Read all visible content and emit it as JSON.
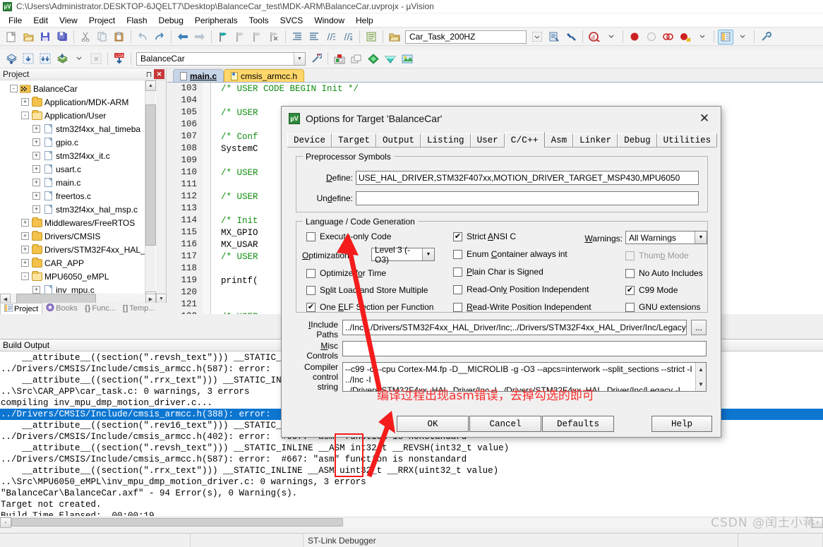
{
  "window": {
    "title": "C:\\Users\\Administrator.DESKTOP-6JQELT7\\Desktop\\BalanceCar_test\\MDK-ARM\\BalanceCar.uvprojx  -  µVision",
    "app_icon": "uvision-icon"
  },
  "menubar": {
    "items": [
      "File",
      "Edit",
      "View",
      "Project",
      "Flash",
      "Debug",
      "Peripherals",
      "Tools",
      "SVCS",
      "Window",
      "Help"
    ]
  },
  "toolbar1": {
    "target_combo_value": "Car_Task_200HZ",
    "icons": [
      "new-file-icon",
      "open-file-icon",
      "save-icon",
      "save-all-icon",
      "cut-icon",
      "copy-icon",
      "paste-icon",
      "undo-icon",
      "redo-icon",
      "navigate-back-icon",
      "navigate-forward-icon",
      "bookmark-toggle-icon",
      "bookmark-prev-icon",
      "bookmark-next-icon",
      "bookmark-clear-icon",
      "indent-icon",
      "outdent-icon",
      "comment-icon",
      "uncomment-icon"
    ]
  },
  "toolbar2": {
    "project_combo_value": "BalanceCar",
    "icons": [
      "build-icon",
      "rebuild-icon",
      "batch-build-icon",
      "translate-icon",
      "stop-build-icon",
      "download-icon",
      "target-options-icon",
      "manage-components-icon",
      "multi-project-icon",
      "pack-installer-icon",
      "pack-icon",
      "pack-manager-icon"
    ]
  },
  "project_panel": {
    "header": "Project",
    "pin_icon": "pin-icon",
    "close_icon": "close-icon",
    "tree": [
      {
        "label": "BalanceCar",
        "icon": "project-target-icon",
        "depth": 1,
        "expander": "-"
      },
      {
        "label": "Application/MDK-ARM",
        "icon": "folder-icon",
        "depth": 2,
        "expander": "+"
      },
      {
        "label": "Application/User",
        "icon": "folder-open-icon",
        "depth": 2,
        "expander": "-"
      },
      {
        "label": "stm32f4xx_hal_timeba",
        "icon": "c-file-icon",
        "depth": 3,
        "expander": "+"
      },
      {
        "label": "gpio.c",
        "icon": "c-file-icon",
        "depth": 3,
        "expander": "+"
      },
      {
        "label": "stm32f4xx_it.c",
        "icon": "c-file-icon",
        "depth": 3,
        "expander": "+"
      },
      {
        "label": "usart.c",
        "icon": "c-file-icon",
        "depth": 3,
        "expander": "+"
      },
      {
        "label": "main.c",
        "icon": "c-file-icon",
        "depth": 3,
        "expander": "+"
      },
      {
        "label": "freertos.c",
        "icon": "c-file-icon",
        "depth": 3,
        "expander": "+"
      },
      {
        "label": "stm32f4xx_hal_msp.c",
        "icon": "c-file-icon",
        "depth": 3,
        "expander": "+"
      },
      {
        "label": "Middlewares/FreeRTOS",
        "icon": "folder-icon",
        "depth": 2,
        "expander": "+"
      },
      {
        "label": "Drivers/CMSIS",
        "icon": "folder-icon",
        "depth": 2,
        "expander": "+"
      },
      {
        "label": "Drivers/STM32F4xx_HAL_",
        "icon": "folder-icon",
        "depth": 2,
        "expander": "+"
      },
      {
        "label": "CAR_APP",
        "icon": "folder-icon",
        "depth": 2,
        "expander": "+"
      },
      {
        "label": "MPU6050_eMPL",
        "icon": "folder-open-icon",
        "depth": 2,
        "expander": "-"
      },
      {
        "label": "inv_mpu.c",
        "icon": "c-file-icon",
        "depth": 3,
        "expander": "+"
      }
    ],
    "tabs": [
      {
        "label": "Project",
        "icon": "project-icon",
        "selected": true
      },
      {
        "label": "Books",
        "icon": "books-icon",
        "selected": false
      },
      {
        "label": "Func...",
        "icon": "functions-icon",
        "selected": false
      },
      {
        "label": "Temp...",
        "icon": "templates-icon",
        "selected": false
      }
    ]
  },
  "editor": {
    "tabs": [
      {
        "label": "main.c",
        "icon": "c-file-icon",
        "selected": true
      },
      {
        "label": "cmsis_armcc.h",
        "icon": "h-file-icon",
        "selected": false
      }
    ],
    "lines": [
      {
        "num": "103",
        "text": "/* USER CODE BEGIN Init */",
        "kind": "comment"
      },
      {
        "num": "104",
        "text": "",
        "kind": "plain"
      },
      {
        "num": "105",
        "text": "/* USER",
        "kind": "comment"
      },
      {
        "num": "106",
        "text": "",
        "kind": "plain"
      },
      {
        "num": "107",
        "text": "/* Conf",
        "kind": "comment"
      },
      {
        "num": "108",
        "text": "SystemC",
        "kind": "plain"
      },
      {
        "num": "109",
        "text": "",
        "kind": "plain"
      },
      {
        "num": "110",
        "text": "/* USER",
        "kind": "comment"
      },
      {
        "num": "111",
        "text": "",
        "kind": "plain"
      },
      {
        "num": "112",
        "text": "/* USER",
        "kind": "comment"
      },
      {
        "num": "113",
        "text": "",
        "kind": "plain"
      },
      {
        "num": "114",
        "text": "/* Init",
        "kind": "comment"
      },
      {
        "num": "115",
        "text": "MX_GPIO",
        "kind": "plain"
      },
      {
        "num": "116",
        "text": "MX_USAR",
        "kind": "plain"
      },
      {
        "num": "117",
        "text": "/* USER",
        "kind": "comment"
      },
      {
        "num": "118",
        "text": "",
        "kind": "plain"
      },
      {
        "num": "119",
        "text": "printf(",
        "kind": "plain"
      },
      {
        "num": "120",
        "text": "",
        "kind": "plain"
      },
      {
        "num": "121",
        "text": "",
        "kind": "plain"
      },
      {
        "num": "122",
        "text": "/* USER",
        "kind": "comment"
      },
      {
        "num": "123",
        "text": "",
        "kind": "plain"
      }
    ]
  },
  "build_output": {
    "header": "Build Output",
    "lines": [
      {
        "text": "    __attribute__((section(\".revsh_text\"))) __STATIC_INLINE __ASM int32_t __REVSH(int32_t value)",
        "selected": false
      },
      {
        "text": "../Drivers/CMSIS/Include/cmsis_armcc.h(587): error:  #667: \"asm\" function is nonstandard",
        "selected": false
      },
      {
        "text": "    __attribute__((section(\".rrx_text\"))) __STATIC_INLINE __ASM uint32_t __RRX(uint32_t value)",
        "selected": false
      },
      {
        "text": "..\\Src\\CAR_APP\\car_task.c: 0 warnings, 3 errors",
        "selected": false
      },
      {
        "text": "compiling inv_mpu_dmp_motion_driver.c...",
        "selected": false
      },
      {
        "text": "../Drivers/CMSIS/Include/cmsis_armcc.h(388): error:  #667: \"asm\" function is nonstandard",
        "selected": true
      },
      {
        "text": "    __attribute__((section(\".rev16_text\"))) __STATIC_INLINE __ASM uint32_t __REV16(uint32_t value)",
        "selected": false
      },
      {
        "text": "../Drivers/CMSIS/Include/cmsis_armcc.h(402): error:  #667: \"asm\" function is nonstandard",
        "selected": false
      },
      {
        "text": "    __attribute__((section(\".revsh_text\"))) __STATIC_INLINE __ASM int32_t __REVSH(int32_t value)",
        "selected": false
      },
      {
        "text": "../Drivers/CMSIS/Include/cmsis_armcc.h(587): error:  #667: \"asm\" function is nonstandard",
        "selected": false
      },
      {
        "text": "    __attribute__((section(\".rrx_text\"))) __STATIC_INLINE __ASM uint32_t __RRX(uint32_t value)",
        "selected": false
      },
      {
        "text": "..\\Src\\MPU6050_eMPL\\inv_mpu_dmp_motion_driver.c: 0 warnings, 3 errors",
        "selected": false
      },
      {
        "text": "\"BalanceCar\\BalanceCar.axf\" - 94 Error(s), 0 Warning(s).",
        "selected": false
      },
      {
        "text": "Target not created.",
        "selected": false
      },
      {
        "text": "Build Time Elapsed:  00:00:19",
        "selected": false
      }
    ]
  },
  "statusbar": {
    "debugger": "ST-Link Debugger"
  },
  "watermark": "CSDN @闰土小蒋",
  "dialog": {
    "icon": "uvision-icon",
    "title": "Options for Target 'BalanceCar'",
    "close_label": "✕",
    "tabs": [
      {
        "label": "Device",
        "selected": false
      },
      {
        "label": "Target",
        "selected": false
      },
      {
        "label": "Output",
        "selected": false
      },
      {
        "label": "Listing",
        "selected": false
      },
      {
        "label": "User",
        "selected": false
      },
      {
        "label": "C/C++",
        "selected": true
      },
      {
        "label": "Asm",
        "selected": false
      },
      {
        "label": "Linker",
        "selected": false
      },
      {
        "label": "Debug",
        "selected": false
      },
      {
        "label": "Utilities",
        "selected": false
      }
    ],
    "preprocessor": {
      "legend": "Preprocessor Symbols",
      "define_label": "Define:",
      "define_value": "USE_HAL_DRIVER,STM32F407xx,MOTION_DRIVER_TARGET_MSP430,MPU6050",
      "undefine_label": "Undefine:",
      "undefine_value": ""
    },
    "language": {
      "legend": "Language / Code Generation",
      "col1": [
        {
          "label": "Execute-only Code",
          "checked": false,
          "disabled": false
        },
        {
          "label": "Optimize for Time",
          "checked": false,
          "disabled": false
        },
        {
          "label": "Split Load and Store Multiple",
          "checked": false,
          "disabled": false
        },
        {
          "label": "One ELF Section per Function",
          "checked": true,
          "disabled": false
        }
      ],
      "optimization_label": "Optimization:",
      "optimization_value": "Level 3 (-O3)",
      "col2": [
        {
          "label": "Strict ANSI C",
          "checked": true,
          "disabled": false
        },
        {
          "label": "Enum Container always int",
          "checked": false,
          "disabled": false
        },
        {
          "label": "Plain Char is Signed",
          "checked": false,
          "disabled": false
        },
        {
          "label": "Read-Only Position Independent",
          "checked": false,
          "disabled": false
        },
        {
          "label": "Read-Write Position Independent",
          "checked": false,
          "disabled": false
        }
      ],
      "warnings_label": "Warnings:",
      "warnings_value": "All Warnings",
      "col3": [
        {
          "label": "Thumb Mode",
          "checked": false,
          "disabled": true
        },
        {
          "label": "No Auto Includes",
          "checked": false,
          "disabled": false
        },
        {
          "label": "C99 Mode",
          "checked": true,
          "disabled": false
        },
        {
          "label": "GNU extensions",
          "checked": false,
          "disabled": false
        }
      ]
    },
    "include_paths_label_1": "Include",
    "include_paths_label_2": "Paths",
    "include_paths_value": "../Inc;../Drivers/STM32F4xx_HAL_Driver/Inc;../Drivers/STM32F4xx_HAL_Driver/Inc/Legacy;../Mid",
    "include_browse_label": "...",
    "misc_label_1": "Misc",
    "misc_label_2": "Controls",
    "misc_value": "",
    "compiler_label_1": "Compiler",
    "compiler_label_2": "control",
    "compiler_label_3": "string",
    "compiler_value_line1": "--c99 -c --cpu Cortex-M4.fp -D__MICROLIB -g -O3 --apcs=interwork --split_sections --strict -I ../Inc -I",
    "compiler_value_line2": "../Drivers/STM32F4xx_HAL_Driver/Inc -I ../Drivers/STM32F4xx_HAL_Driver/Inc/Legacy -I",
    "buttons": [
      {
        "label": "OK"
      },
      {
        "label": "Cancel"
      },
      {
        "label": "Defaults"
      },
      {
        "label": "Help"
      }
    ]
  },
  "annotation": {
    "text": "编译过程出现asm错误，去掉勾选的即可",
    "color": "#fb2c2c"
  }
}
